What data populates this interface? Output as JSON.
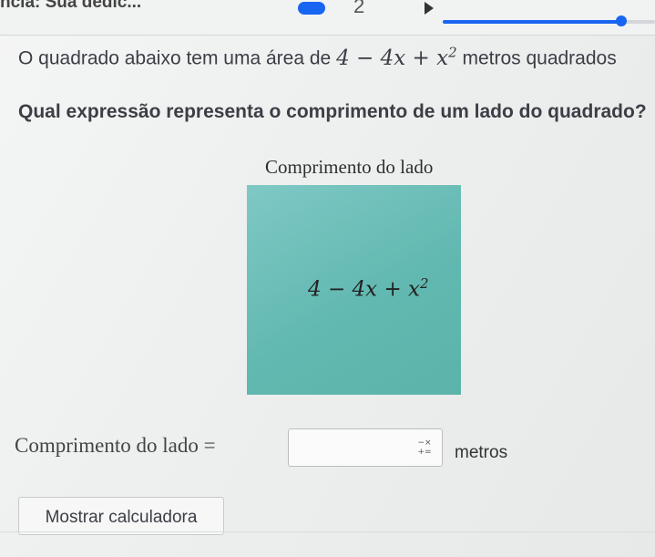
{
  "header": {
    "dedication": "ncia: Sua dedic...",
    "step_number": "2",
    "progress_fraction": 0.84
  },
  "question": {
    "line1_prefix": "O quadrado abaixo tem uma área de",
    "area_expression": "4 − 4x + x",
    "area_exponent": "2",
    "line1_suffix": "metros quadrados",
    "line2": "Qual expressão representa o comprimento de um lado do quadrado?"
  },
  "figure": {
    "title": "Comprimento do lado",
    "label_expression": "4 − 4x + x",
    "label_exponent": "2",
    "fill_color": "#62b9b1"
  },
  "answer": {
    "label": "Comprimento do lado =",
    "value": "",
    "keypad_icon_top": "−×",
    "keypad_icon_bottom": "+=",
    "unit": "metros"
  },
  "actions": {
    "calculator_label": "Mostrar calculadora"
  }
}
